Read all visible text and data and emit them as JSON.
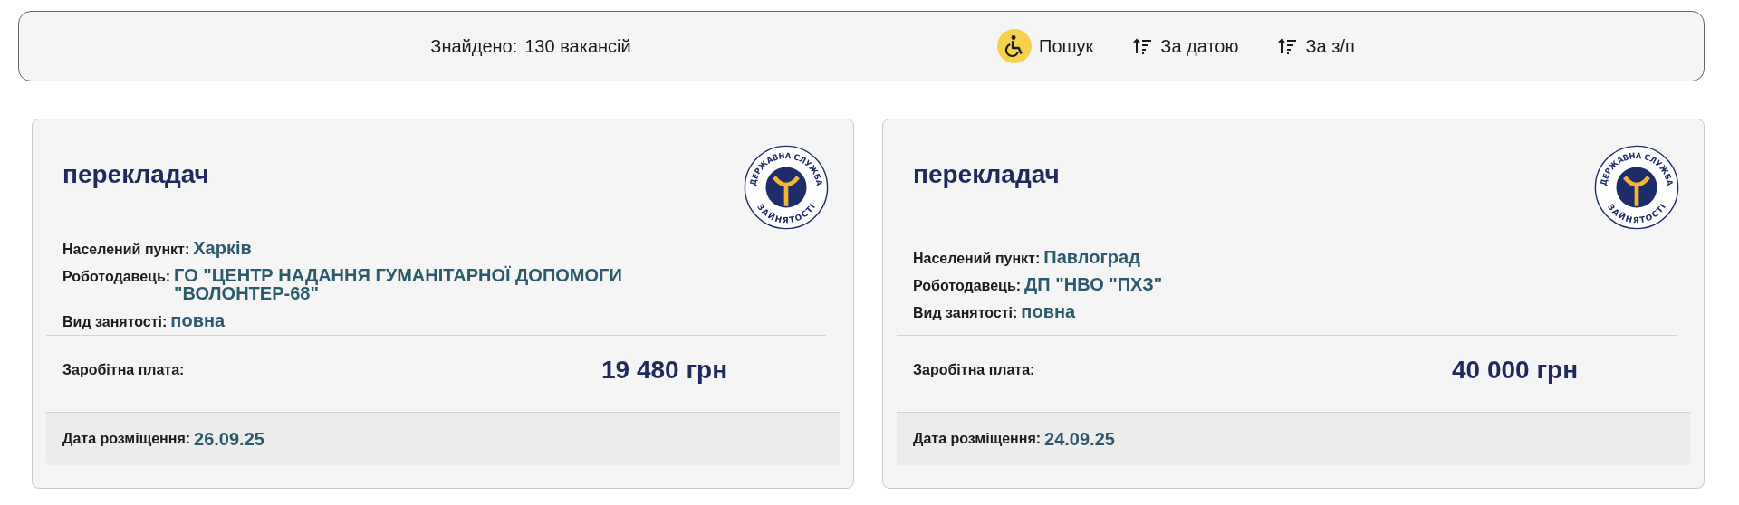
{
  "toolbar": {
    "found_label": "Знайдено:",
    "found_count": "130 вакансій",
    "search_button": "Пошук",
    "sorts": [
      {
        "label": "За датою"
      },
      {
        "label": "За з/п"
      }
    ]
  },
  "vacancies": [
    {
      "title": "перекладач",
      "logo_top": "ДЕРЖАВНА СЛУЖБА",
      "logo_bottom": "ЗАЙНЯТОСТІ",
      "fields": [
        {
          "label": "Населений пункт:",
          "value": "Харків"
        },
        {
          "label": "Роботодавець:",
          "value": "ГО \"ЦЕНТР НАДАННЯ ГУМАНІТАРНОЇ ДОПОМОГИ \"ВОЛОНТЕР-68\""
        },
        {
          "label": "Вид занятості:",
          "value": "повна"
        }
      ],
      "salary_label": "Заробітна плата:",
      "salary": "19 480 грн",
      "date_label": "Дата розміщення:",
      "date": "26.09.25"
    },
    {
      "title": "перекладач",
      "logo_top": "ДЕРЖАВНА СЛУЖБА",
      "logo_bottom": "ЗАЙНЯТОСТІ",
      "fields": [
        {
          "label": "Населений пункт:",
          "value": "Павлоград"
        },
        {
          "label": "Роботодавець:",
          "value": "ДП \"НВО \"ПХЗ\""
        },
        {
          "label": "Вид занятості:",
          "value": "повна"
        }
      ],
      "salary_label": "Заробітна плата:",
      "salary": "40 000 грн",
      "date_label": "Дата розміщення:",
      "date": "24.09.25"
    }
  ]
}
